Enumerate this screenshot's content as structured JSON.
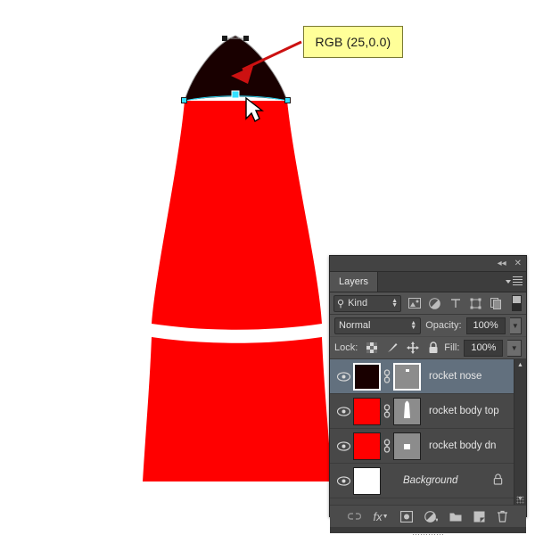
{
  "callout": {
    "text": "RGB (25,0.0)",
    "bg_color": "#ffff99",
    "arrow_color": "#cc1111"
  },
  "canvas": {
    "background": "#ffffff",
    "rocket_body_color": "#ff0000",
    "rocket_nose_color": "#190000",
    "path_anchor_color": "#33e0ff",
    "cursor": "arrow-cursor"
  },
  "panel": {
    "title": "Layers",
    "topbar": {
      "collapse_icon": "double-left-arrows-icon",
      "close_icon": "close-icon"
    },
    "menu_icon": "panel-menu-icon",
    "filter": {
      "search_icon": "search-icon",
      "kind_label": "Kind",
      "icons": [
        "pixel-layer-filter-icon",
        "adjustment-layer-filter-icon",
        "type-layer-filter-icon",
        "shape-layer-filter-icon",
        "smart-object-filter-icon"
      ],
      "toggle_icon": "filter-toggle-switch"
    },
    "mode": {
      "blend_label": "Normal",
      "opacity_label": "Opacity:",
      "opacity_value": "100%"
    },
    "lock": {
      "lock_label": "Lock:",
      "icons": [
        "lock-transparent-pixels-icon",
        "lock-image-pixels-icon",
        "lock-position-icon",
        "lock-all-icon"
      ],
      "fill_label": "Fill:",
      "fill_value": "100%"
    },
    "layers": [
      {
        "name": "rocket nose",
        "thumb_color": "#190000",
        "visible": true,
        "selected": true,
        "linked": true,
        "has_mask": true,
        "mask_shape": "tiny-dot",
        "locked": false
      },
      {
        "name": "rocket body top",
        "thumb_color": "#ff0000",
        "visible": true,
        "selected": false,
        "linked": true,
        "has_mask": true,
        "mask_shape": "rocket-body",
        "locked": false
      },
      {
        "name": "rocket body dn",
        "thumb_color": "#ff0000",
        "visible": true,
        "selected": false,
        "linked": true,
        "has_mask": true,
        "mask_shape": "small-square",
        "locked": false
      },
      {
        "name": "Background",
        "thumb_color": "#ffffff",
        "visible": true,
        "selected": false,
        "linked": false,
        "has_mask": false,
        "mask_shape": "",
        "locked": true
      }
    ],
    "scrollbar": {
      "up_icon": "scroll-up-arrow-icon",
      "down_icon": "scroll-down-arrow-icon"
    },
    "bottom_icons": [
      "link-layers-icon",
      "layer-style-fx-icon",
      "add-layer-mask-icon",
      "new-adjustment-layer-icon",
      "new-group-icon",
      "new-layer-icon",
      "delete-layer-icon"
    ]
  }
}
